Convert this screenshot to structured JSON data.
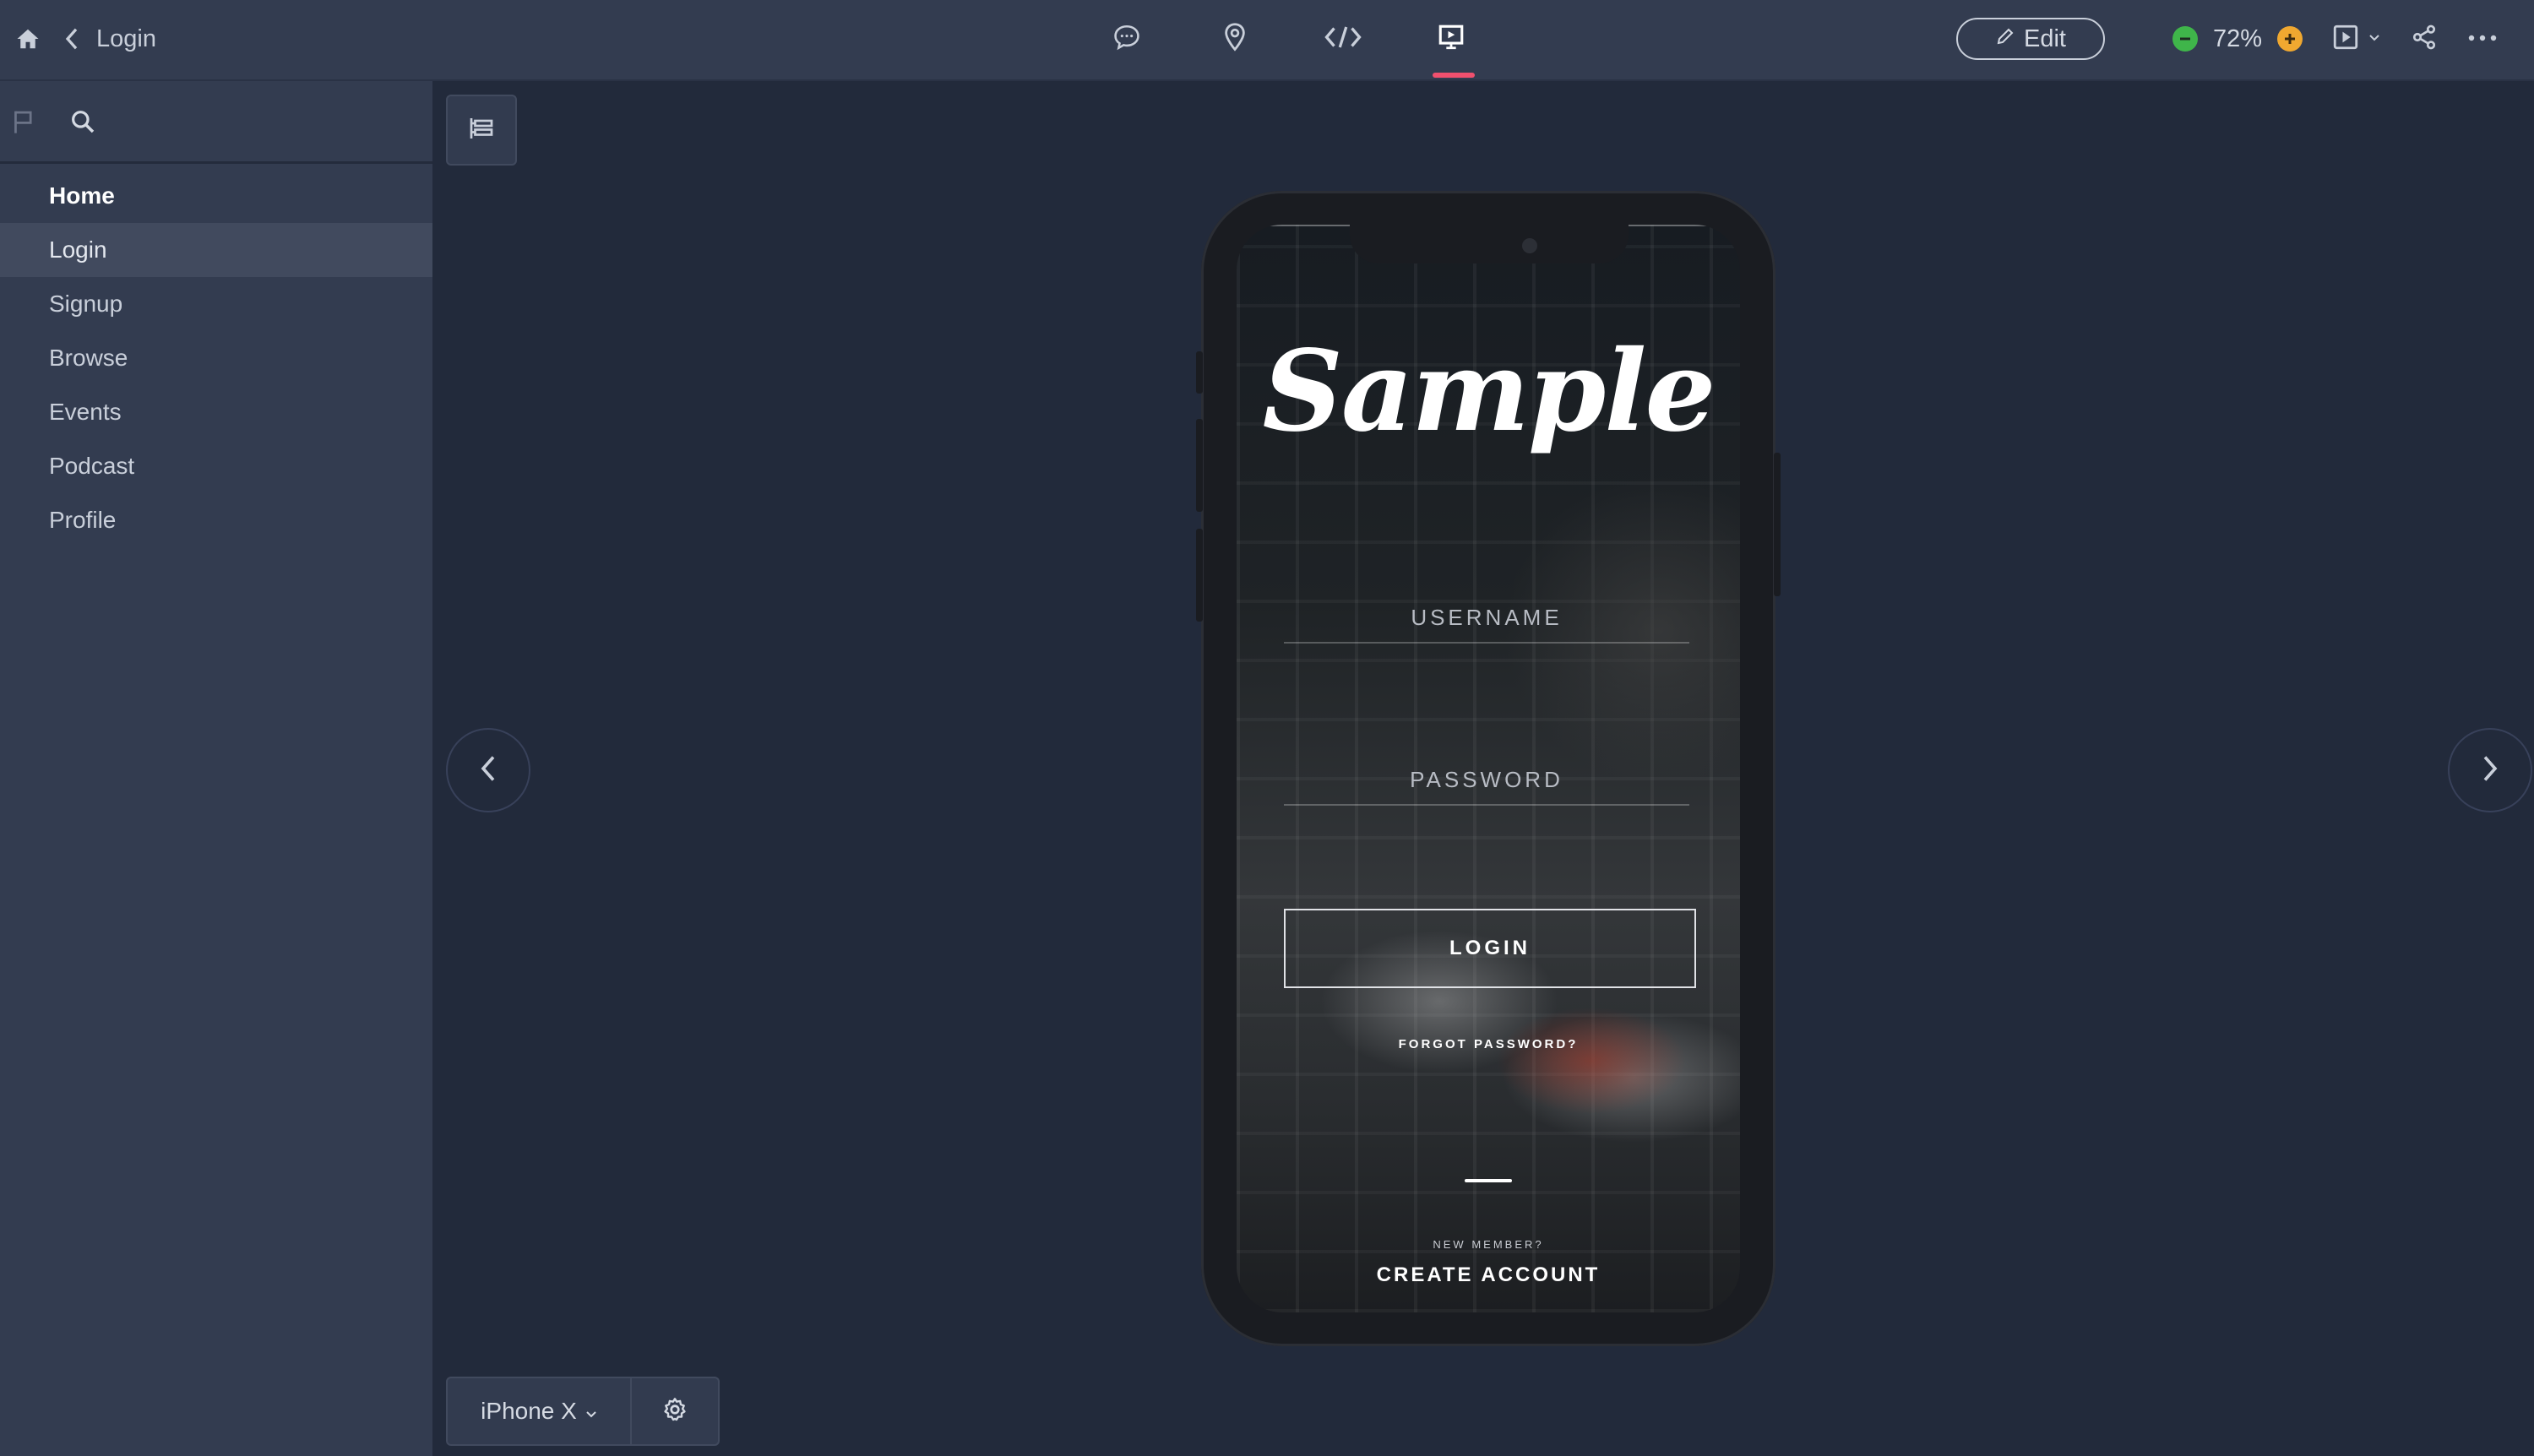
{
  "colors": {
    "accent": "#f0506e",
    "zoom_minus": "#3fb54a",
    "zoom_plus": "#f0a830",
    "panel": "#333c50",
    "canvas": "#222a3b"
  },
  "topbar": {
    "breadcrumb": "Login",
    "edit_label": "Edit",
    "zoom_value": "72%",
    "icons": [
      "home-icon",
      "chevron-left-icon",
      "comment-icon",
      "location-pin-icon",
      "code-icon",
      "preview-icon",
      "pencil-icon",
      "play-icon",
      "chevron-down-icon",
      "share-icon",
      "more-icon"
    ]
  },
  "sidebar": {
    "items": [
      {
        "label": "Home"
      },
      {
        "label": "Login"
      },
      {
        "label": "Signup"
      },
      {
        "label": "Browse"
      },
      {
        "label": "Events"
      },
      {
        "label": "Podcast"
      },
      {
        "label": "Profile"
      }
    ]
  },
  "phone_screen": {
    "logo_text": "Sample",
    "username_placeholder": "USERNAME",
    "password_placeholder": "PASSWORD",
    "login_label": "LOGIN",
    "forgot_label": "FORGOT PASSWORD?",
    "new_member_label": "NEW MEMBER?",
    "create_account_label": "CREATE ACCOUNT"
  },
  "device_bar": {
    "device_label": "iPhone X"
  }
}
